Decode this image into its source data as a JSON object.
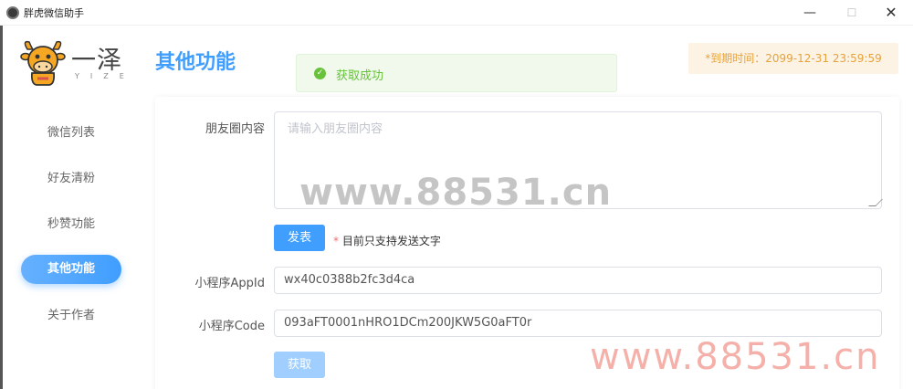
{
  "window": {
    "title": "胖虎微信助手",
    "minimize": "—",
    "maximize": "☐",
    "close": "✕"
  },
  "logo": {
    "name": "一泽",
    "sub": "YIZE"
  },
  "page_title": "其他功能",
  "toast": {
    "icon": "check-icon",
    "message": "获取成功"
  },
  "expiry": {
    "text": "*到期时间：2099-12-31 23:59:59"
  },
  "sidebar": {
    "items": [
      {
        "label": "微信列表",
        "active": false
      },
      {
        "label": "好友清粉",
        "active": false
      },
      {
        "label": "秒赞功能",
        "active": false
      },
      {
        "label": "其他功能",
        "active": true
      },
      {
        "label": "关于作者",
        "active": false
      }
    ]
  },
  "form": {
    "moments_label": "朋友圈内容",
    "moments_placeholder": "请输入朋友圈内容",
    "publish_button": "发表",
    "note_star": "*",
    "note_text": " 目前只支持发送文字",
    "appid_label": "小程序AppId",
    "appid_value": "wx40c0388b2fc3d4ca",
    "code_label": "小程序Code",
    "code_value": "093aFT0001nHRO1DCm200JKW5G0aFT0r",
    "fetch_button": "获取"
  },
  "watermarks": {
    "center": "www.88531.cn",
    "corner": "www.88531.cn"
  },
  "colors": {
    "primary": "#409eff",
    "success": "#67c23a",
    "warning": "#e6a23c"
  }
}
